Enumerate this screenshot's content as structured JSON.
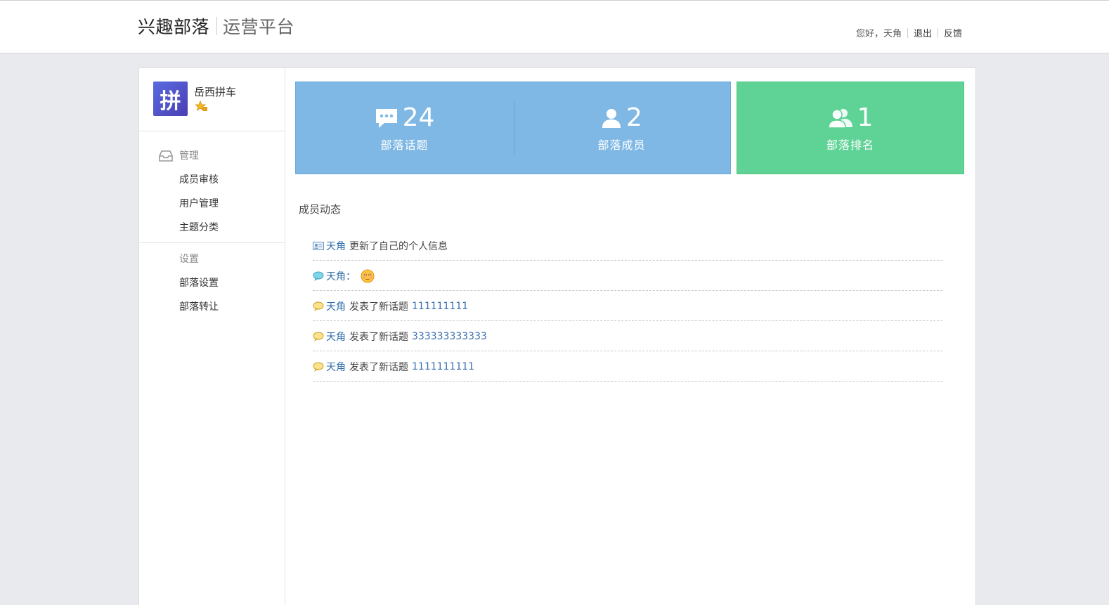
{
  "header": {
    "brand": "兴趣部落",
    "subtitle": "运营平台",
    "greeting": "您好，天角",
    "logout_label": "退出",
    "feedback_label": "反馈"
  },
  "sidebar": {
    "tribe_name": "岳西拼车",
    "avatar_text": "拼",
    "groups": [
      {
        "title": "管理",
        "icon": "inbox-icon",
        "items": [
          "成员审核",
          "用户管理",
          "主题分类"
        ]
      },
      {
        "title": "设置",
        "items": [
          "部落设置",
          "部落转让"
        ]
      }
    ]
  },
  "stats": [
    {
      "value": "24",
      "label": "部落话题",
      "icon": "chat-bubble-icon"
    },
    {
      "value": "2",
      "label": "部落成员",
      "icon": "person-icon"
    },
    {
      "value": "1",
      "label": "部落排名",
      "icon": "people-icon"
    }
  ],
  "colors": {
    "blue_card": "#7fb8e4",
    "green_card": "#5fd395",
    "link": "#2f6ea8"
  },
  "activity": {
    "title": "成员动态",
    "items": [
      {
        "icon": "profile-card-icon",
        "user": "天角",
        "text": "更新了自己的个人信息",
        "link": ""
      },
      {
        "icon": "comment-blue-icon",
        "user": "天角：",
        "text": "",
        "link": "",
        "emoji": "smiley-emoji-icon"
      },
      {
        "icon": "comment-yellow-icon",
        "user": "天角",
        "text": "发表了新话题",
        "link": "111111111"
      },
      {
        "icon": "comment-yellow-icon",
        "user": "天角",
        "text": "发表了新话题",
        "link": "333333333333"
      },
      {
        "icon": "comment-yellow-icon",
        "user": "天角",
        "text": "发表了新话题",
        "link": "1111111111"
      }
    ]
  }
}
